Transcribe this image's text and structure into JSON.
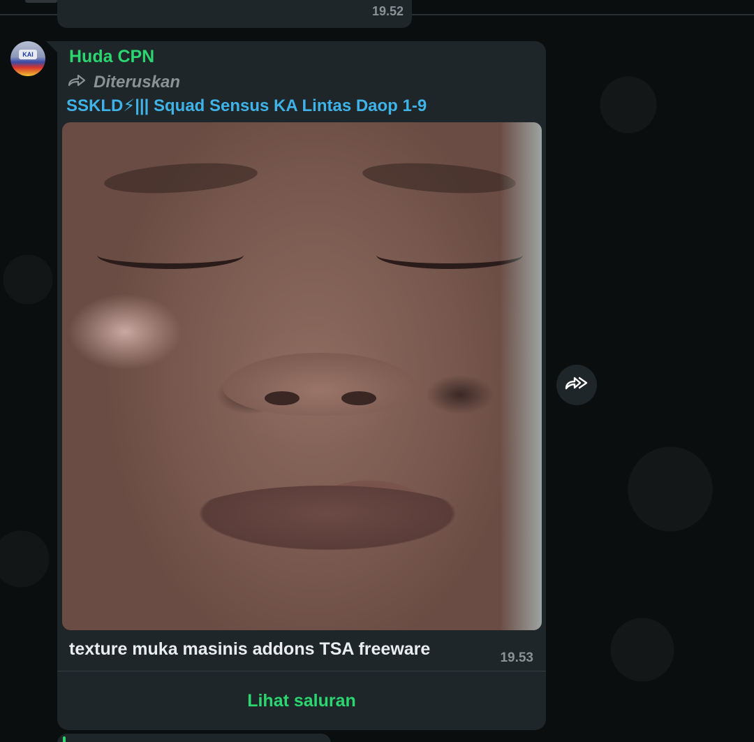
{
  "previous_message": {
    "time": "19.52"
  },
  "message": {
    "sender_name": "Huda CPN",
    "forwarded_label": "Diteruskan",
    "channel_name": "SSKLD⚡||| Squad Sensus KA Lintas Daop 1-9",
    "caption": "texture muka masinis addons TSA freeware",
    "time": "19.53",
    "view_channel_label": "Lihat saluran",
    "avatar_logo_text": "KAI"
  },
  "icons": {
    "forward_indicator": "forward-arrow-icon",
    "forward_button": "double-forward-arrow-icon"
  },
  "colors": {
    "background": "#0b0e0f",
    "bubble": "#1f2629",
    "sender_green": "#2bd56f",
    "channel_blue": "#3fb3e8",
    "muted_text": "#8a9296",
    "primary_text": "#e9edef"
  }
}
